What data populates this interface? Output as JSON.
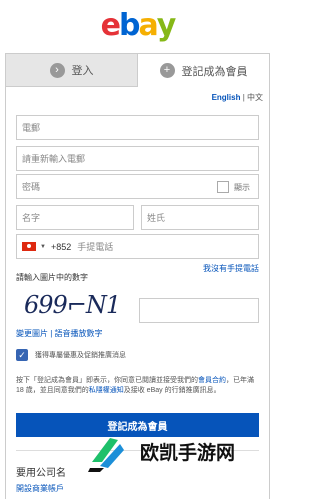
{
  "logo": {
    "letters": [
      "e",
      "b",
      "a",
      "y"
    ],
    "colors": [
      "#e53238",
      "#0064d2",
      "#f5af02",
      "#86b817"
    ]
  },
  "tabs": {
    "login": {
      "label": "登入",
      "icon": "login-arrow-icon"
    },
    "register": {
      "label": "登記成為會員",
      "icon": "plus-icon"
    }
  },
  "lang": {
    "english": "English",
    "separator": "|",
    "chinese": "中文"
  },
  "form": {
    "email_placeholder": "電郵",
    "email_confirm_placeholder": "請重新輸入電郵",
    "password_placeholder": "密碼",
    "show_label": "顯示",
    "first_name_placeholder": "名字",
    "last_name_placeholder": "姓氏",
    "phone_code": "+852",
    "phone_placeholder": "手提電話",
    "no_phone_link": "我沒有手提電話"
  },
  "captcha": {
    "label": "請輸入圖片中的數字",
    "image_text": "699⌐N1",
    "refresh_link": "變更圖片",
    "separator": "|",
    "audio_link": "語音播放數字"
  },
  "promo": {
    "label": "獲得專屬優惠及促銷推廣消息"
  },
  "terms": {
    "text_1": "按下「登記成為會員」即表示，你同意已閱讀並接受我們的",
    "link_1": "會員合約",
    "text_2": "，已年滿 18 歲，並且同意我們的",
    "link_2": "私隱權通知",
    "text_3": "及接收 eBay 的行銷推廣訊息。"
  },
  "submit_label": "登記成為會員",
  "business": {
    "question": "要用公司名",
    "link": "開設商業帳戶"
  },
  "watermark": {
    "text": "欧凯手游网"
  }
}
